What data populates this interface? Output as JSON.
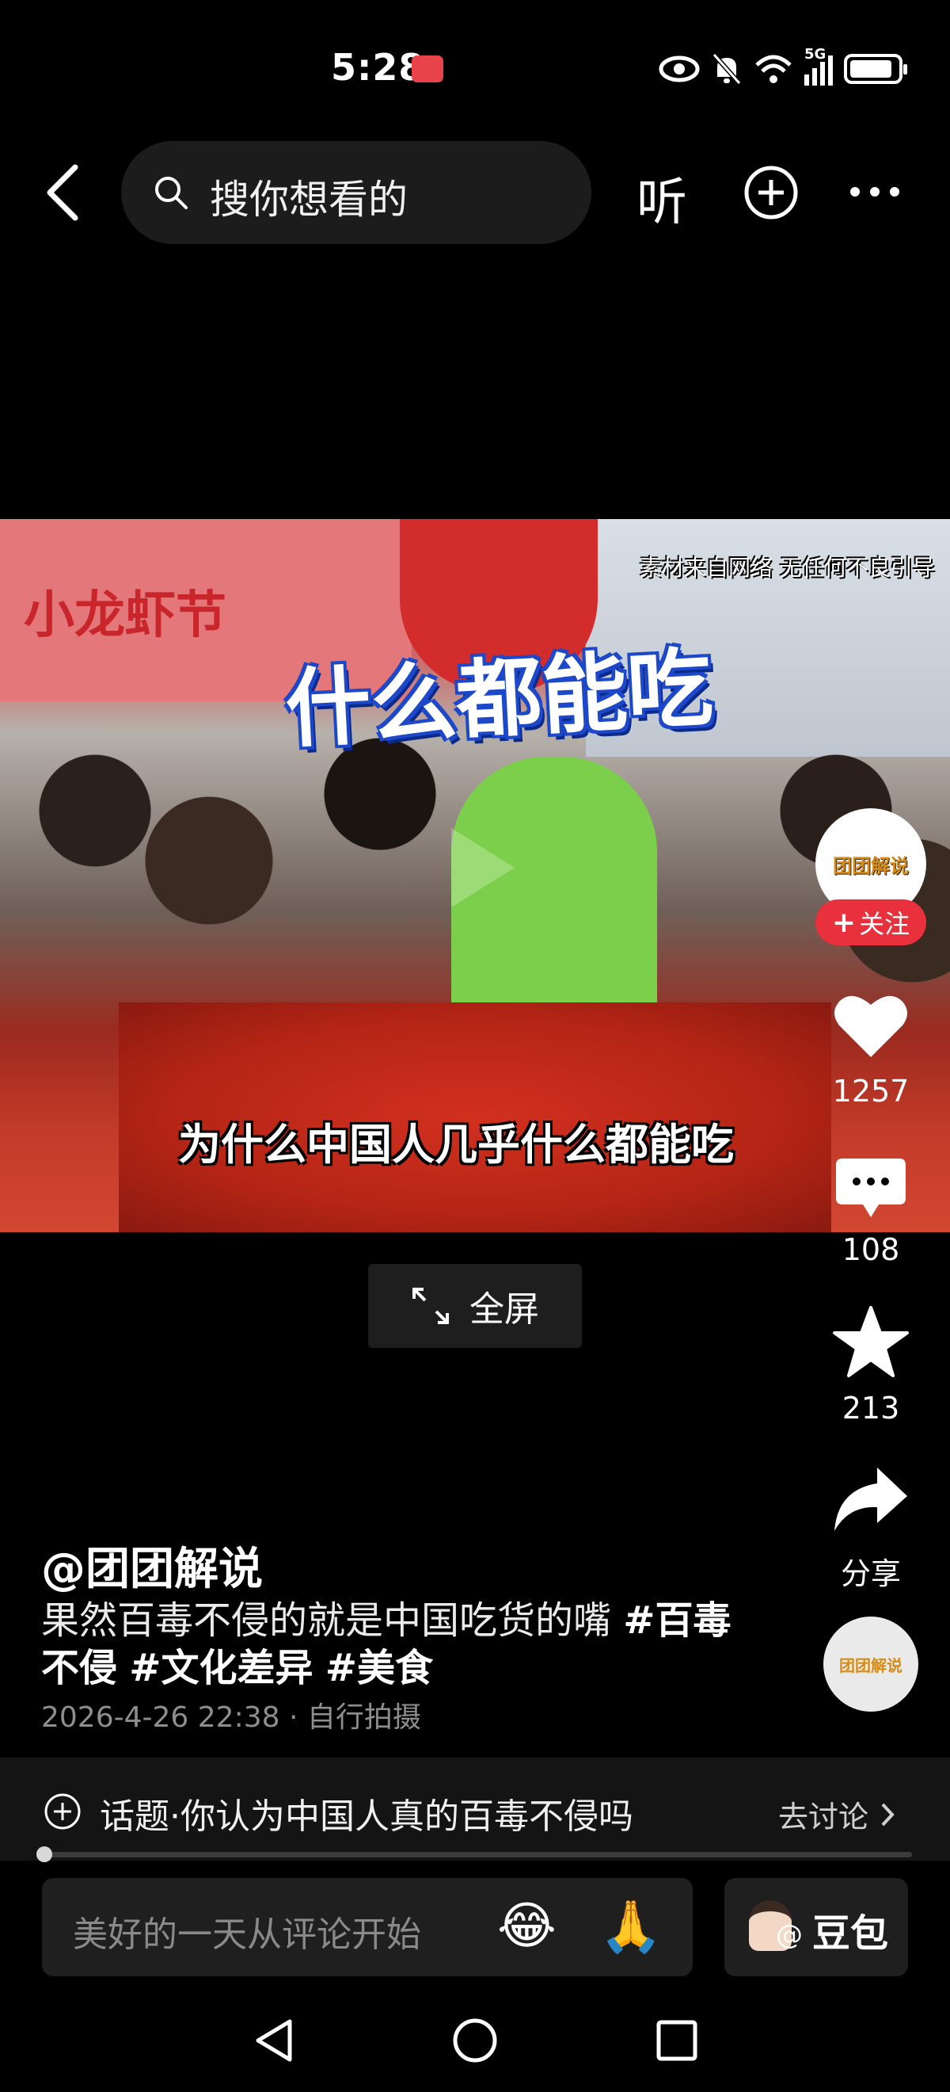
{
  "status_bar": {
    "time": "5:28",
    "network": "5G"
  },
  "top_bar": {
    "search_placeholder": "搜你想看的",
    "listen_label": "听"
  },
  "video": {
    "title_overlay": "什么都能吃",
    "subtitle": "为什么中国人几乎什么都能吃",
    "watermark": "素材来自网络 无任何不良引导",
    "background_sign": "小龙虾节",
    "fullscreen_label": "全屏"
  },
  "side_rail": {
    "avatar_logo": "团团解说",
    "follow_label": "关注",
    "likes": "1257",
    "comments": "108",
    "favorites": "213",
    "share_label": "分享",
    "music_logo": "团团解说"
  },
  "post": {
    "author": "@团团解说",
    "caption_text": "果然百毒不侵的就是中国吃货的嘴 ",
    "hashtags": [
      "#百毒不侵",
      "#文化差异",
      "#美食"
    ],
    "date": "2026-4-26 22:38",
    "source": "自行拍摄"
  },
  "topic": {
    "label": "话题·你认为中国人真的百毒不侵吗",
    "action": "去讨论"
  },
  "comment_input": {
    "placeholder": "美好的一天从评论开始",
    "emoji_1": "😂",
    "emoji_2": "🙏"
  },
  "doubao": {
    "label": "豆包"
  },
  "progress": {
    "fraction": 0.0
  },
  "colors": {
    "follow_red": "#e8313d",
    "background": "#000000"
  }
}
